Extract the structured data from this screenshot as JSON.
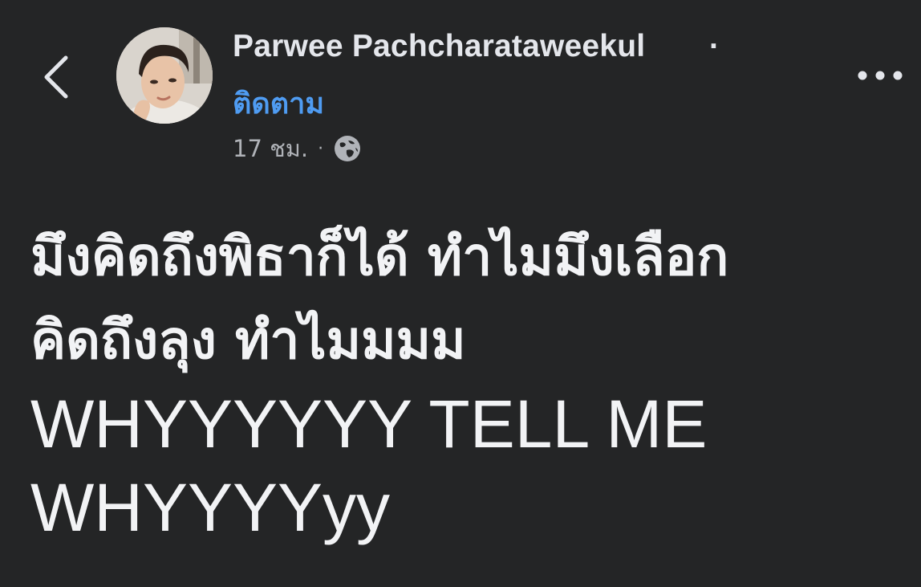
{
  "header": {
    "back_icon": "chevron-left-icon",
    "author_name": "Parwee Pachcharataweekul",
    "name_separator": "·",
    "follow_label": "ติดตาม",
    "timestamp": "17 ชม.",
    "meta_separator": "·",
    "audience_icon": "globe-icon",
    "more_icon": "more-horizontal-icon"
  },
  "post": {
    "lines": [
      "มึงคิดถึงพิธาก็ได้ ทำไมมึงเลือก",
      "คิดถึงลุง ทำไมมมม",
      "WHYYYYYY TELL ME",
      "WHYYYYyy"
    ]
  },
  "colors": {
    "background": "#242526",
    "text_primary": "#e4e6eb",
    "text_secondary": "#b0b3b8",
    "link": "#4f9cf2"
  }
}
